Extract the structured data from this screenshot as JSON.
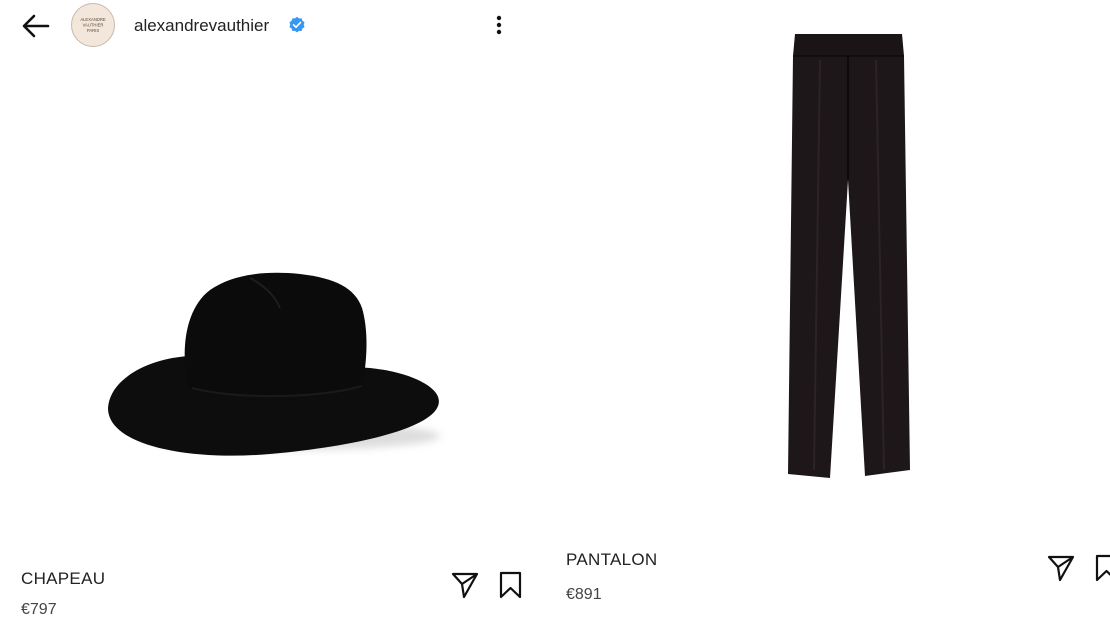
{
  "header": {
    "username": "alexandrevauthier",
    "avatar_text": [
      "ALEXANDRE",
      "VAUTHIER",
      "PARIS"
    ],
    "back_icon": "arrow-left-icon",
    "verified_icon": "verified-badge-icon",
    "more_icon": "more-vertical-icon"
  },
  "products": [
    {
      "name": "CHAPEAU",
      "price": "€797",
      "image": "black-cowboy-hat"
    },
    {
      "name": "PANTALON",
      "price": "€891",
      "image": "black-wide-leg-trousers"
    }
  ],
  "actions": {
    "share_icon": "send-icon",
    "save_icon": "bookmark-icon"
  },
  "colors": {
    "verified": "#3897f0",
    "text": "#222222",
    "product": "#0d0d0d"
  }
}
